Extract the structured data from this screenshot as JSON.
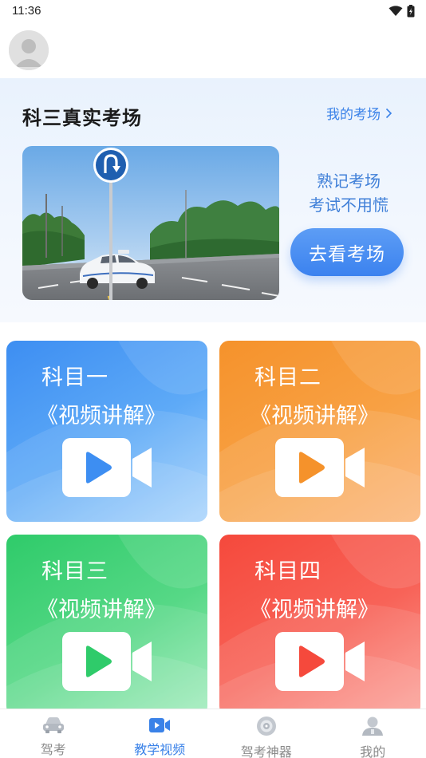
{
  "status_bar": {
    "time": "11:36"
  },
  "exam": {
    "title": "科三真实考场",
    "my_exam_link": "我的考场",
    "slogan_line1": "熟记考场",
    "slogan_line2": "考试不用慌",
    "go_button": "去看考场",
    "sign_icon": "u-turn-sign-icon"
  },
  "subjects": [
    {
      "title": "科目一",
      "subtitle": "《视频讲解》",
      "icon_color": "#3d8ef2"
    },
    {
      "title": "科目二",
      "subtitle": "《视频讲解》",
      "icon_color": "#f5922b"
    },
    {
      "title": "科目三",
      "subtitle": "《视频讲解》",
      "icon_color": "#2fcb6a"
    },
    {
      "title": "科目四",
      "subtitle": "《视频讲解》",
      "icon_color": "#f5493c"
    }
  ],
  "nav": [
    {
      "label": "驾考",
      "icon": "car-icon",
      "active": false
    },
    {
      "label": "教学视频",
      "icon": "video-camera-icon",
      "active": true
    },
    {
      "label": "驾考神器",
      "icon": "compass-icon",
      "active": false
    },
    {
      "label": "我的",
      "icon": "profile-icon",
      "active": false
    }
  ],
  "colors": {
    "accent": "#3a82e8",
    "inactive": "#8a8a8a"
  }
}
